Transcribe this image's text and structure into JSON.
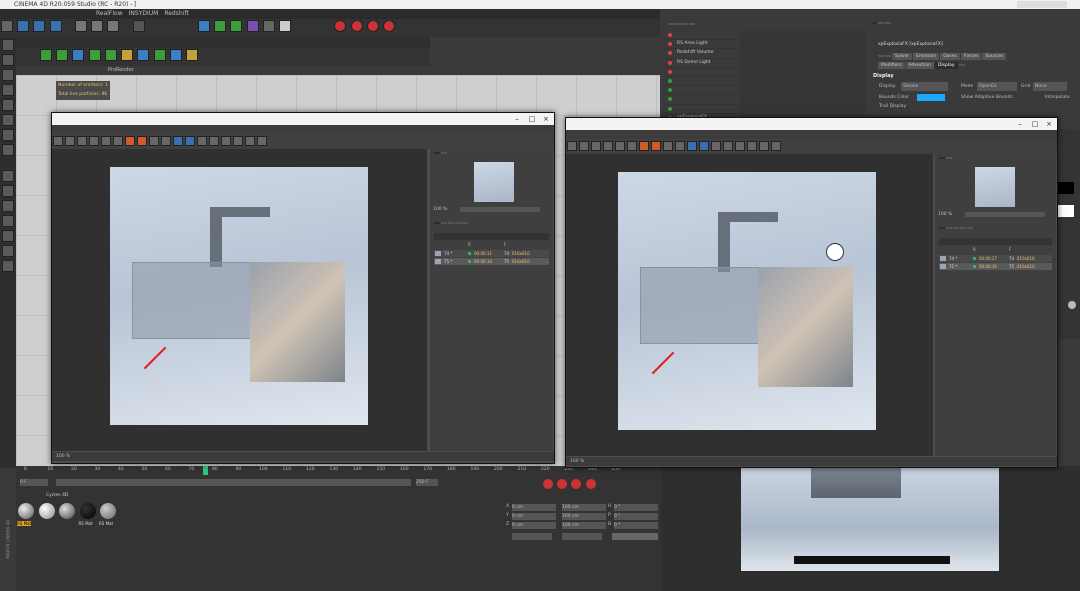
{
  "app": {
    "window_title": "CINEMA 4D R20.059 Studio (RC - R20) - [",
    "layout_selector": ""
  },
  "menus": {
    "main": [
      "",
      "",
      "",
      "",
      "",
      "",
      "",
      "",
      "",
      "",
      "",
      "",
      "",
      "",
      "",
      "",
      "RealFlow",
      "INSYDIUM",
      "Redshift",
      "",
      "",
      ""
    ]
  },
  "viewport": {
    "menu": [
      "",
      "",
      "",
      "",
      "",
      "",
      "ProRender"
    ],
    "hud_line1": "Number of emitters: 1",
    "hud_line2": "Total live particles: 86"
  },
  "object_manager": {
    "tabs": [
      "",
      "",
      "",
      ""
    ],
    "items": [
      "",
      "RS Area Light",
      "Redshift Volume",
      "RS Dome Light",
      "",
      "",
      "",
      "",
      "",
      "xpExplosiaFX"
    ]
  },
  "attributes": {
    "tabs": [
      "",
      "",
      ""
    ],
    "object_name": "xpExplosiaFX [xpExplosiaFX]",
    "row1": [
      "",
      "",
      "Solver",
      "Emission",
      "Gases",
      "Forces",
      "Sources"
    ],
    "row2": [
      "Modifiers",
      "Advection",
      "Display",
      ""
    ],
    "section": "Display",
    "display_label": "Display",
    "display_value": "Smoke",
    "mode_label": "Mode",
    "mode_value": "OpenGL",
    "grid_label": "Grid",
    "grid_value": "None",
    "bounds_color_label": "Bounds Color",
    "adaptive_label": "Show Adaptive Bounds",
    "interpolate_label": "Interpolate",
    "trail_label": "Trail Display",
    "accent_color": "#1ea7ff"
  },
  "picture_viewer_left": {
    "title": "",
    "menu": [
      "",
      "",
      "",
      "",
      ""
    ],
    "side_tabs": [
      "",
      ""
    ],
    "zoom": "100 %",
    "history_tabs": [
      "",
      "",
      "",
      "",
      ""
    ],
    "history_header": "",
    "columns": [
      "",
      "R",
      "",
      "F",
      ""
    ],
    "rows": [
      {
        "name": "74 *",
        "time": "00:00:11",
        "frame": "74",
        "size": "616x616"
      },
      {
        "name": "75 *",
        "time": "00:00:10",
        "frame": "75",
        "size": "616x616"
      }
    ],
    "status_zoom": "100 %",
    "status_text": ""
  },
  "picture_viewer_right": {
    "title": "",
    "menu": [
      "",
      "",
      "",
      "",
      ""
    ],
    "side_tabs": [
      "",
      ""
    ],
    "zoom": "100 %",
    "history_tabs": [
      "",
      "",
      "",
      "",
      ""
    ],
    "history_header": "",
    "columns": [
      "",
      "R",
      "",
      "F",
      ""
    ],
    "rows": [
      {
        "name": "74 *",
        "time": "00:00:17",
        "frame": "74",
        "size": "616x616"
      },
      {
        "name": "75 *",
        "time": "00:00:16",
        "frame": "75",
        "size": "616x616"
      }
    ],
    "status_zoom": "100 %",
    "status_text": ""
  },
  "timeline": {
    "ticks": [
      "0",
      "10",
      "20",
      "30",
      "40",
      "50",
      "60",
      "70",
      "80",
      "90",
      "100",
      "110",
      "120",
      "130",
      "140",
      "150",
      "160",
      "170",
      "180",
      "190",
      "200",
      "210",
      "220",
      "230",
      "240",
      "250"
    ],
    "current_frame": "75",
    "start": "0 F",
    "end": "250 F",
    "end2": "250 F"
  },
  "materials": {
    "menu": [
      "",
      "",
      "",
      "",
      "Cycles 4D"
    ],
    "items": [
      "RS Mat",
      "",
      "",
      "RS Mat",
      "RS Mat"
    ]
  },
  "coordinates": {
    "headers": [
      "",
      "",
      ""
    ],
    "rows": [
      {
        "axis": "X",
        "pos": "0 cm",
        "size": "100 cm",
        "rot_label": "H",
        "rot": "0 °"
      },
      {
        "axis": "Y",
        "pos": "0 cm",
        "size": "100 cm",
        "rot_label": "P",
        "rot": "0 °"
      },
      {
        "axis": "Z",
        "pos": "0 cm",
        "size": "100 cm",
        "rot_label": "B",
        "rot": "0 °"
      }
    ],
    "mode1": "",
    "mode2": "",
    "apply": ""
  },
  "subtitle": "",
  "brand": "MAXON CINEMA 4D"
}
